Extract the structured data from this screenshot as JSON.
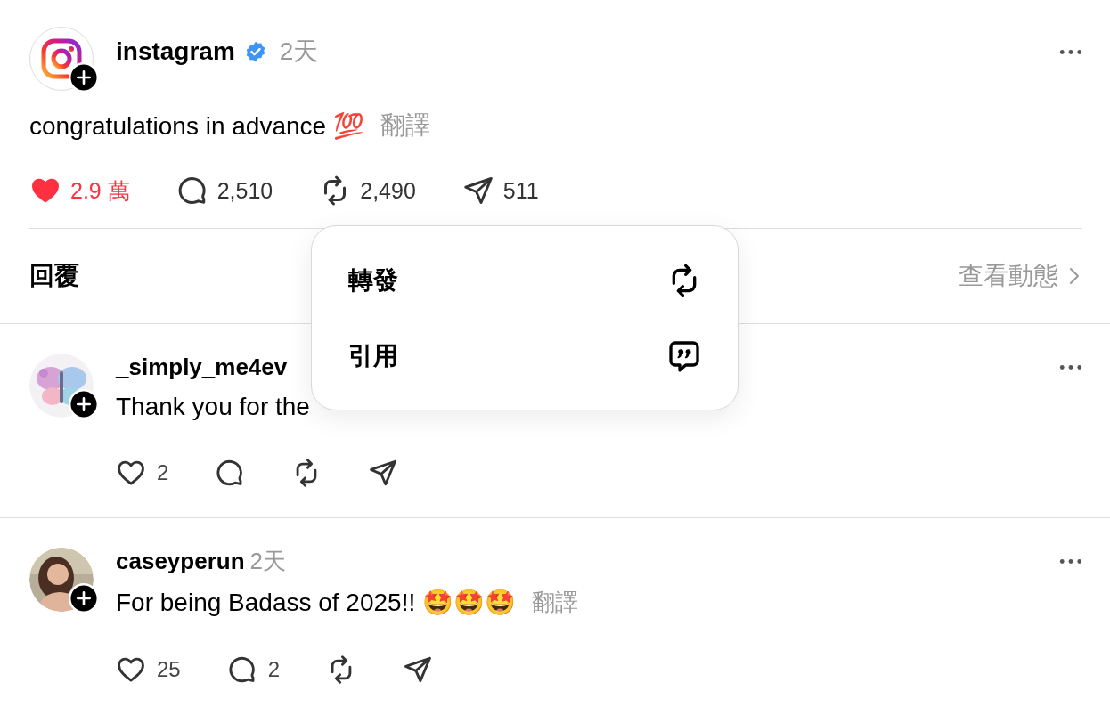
{
  "post": {
    "author": "instagram",
    "verified": true,
    "time": "2天",
    "text": "congratulations in advance 💯",
    "translate": "翻譯",
    "actions": [
      {
        "kind": "like",
        "count": "2.9 萬",
        "liked": true
      },
      {
        "kind": "comment",
        "count": "2,510"
      },
      {
        "kind": "repost",
        "count": "2,490"
      },
      {
        "kind": "share",
        "count": "511"
      }
    ]
  },
  "replies_bar": {
    "label": "回覆",
    "link": "查看動態"
  },
  "replies": [
    {
      "author": "_simply_me4ev",
      "text": "Thank you for the",
      "actions": [
        {
          "kind": "like",
          "count": "2",
          "liked": false
        },
        {
          "kind": "comment"
        },
        {
          "kind": "repost"
        },
        {
          "kind": "share"
        }
      ]
    },
    {
      "author": "caseyperun",
      "time": "2天",
      "text": "For being Badass of 2025!! 🤩🤩🤩",
      "translate": "翻譯",
      "actions": [
        {
          "kind": "like",
          "count": "25",
          "liked": false
        },
        {
          "kind": "comment",
          "count": "2"
        },
        {
          "kind": "repost"
        },
        {
          "kind": "share"
        }
      ]
    }
  ],
  "menu": {
    "items": [
      {
        "kind": "repost",
        "label": "轉發"
      },
      {
        "kind": "quote",
        "label": "引用"
      }
    ]
  }
}
